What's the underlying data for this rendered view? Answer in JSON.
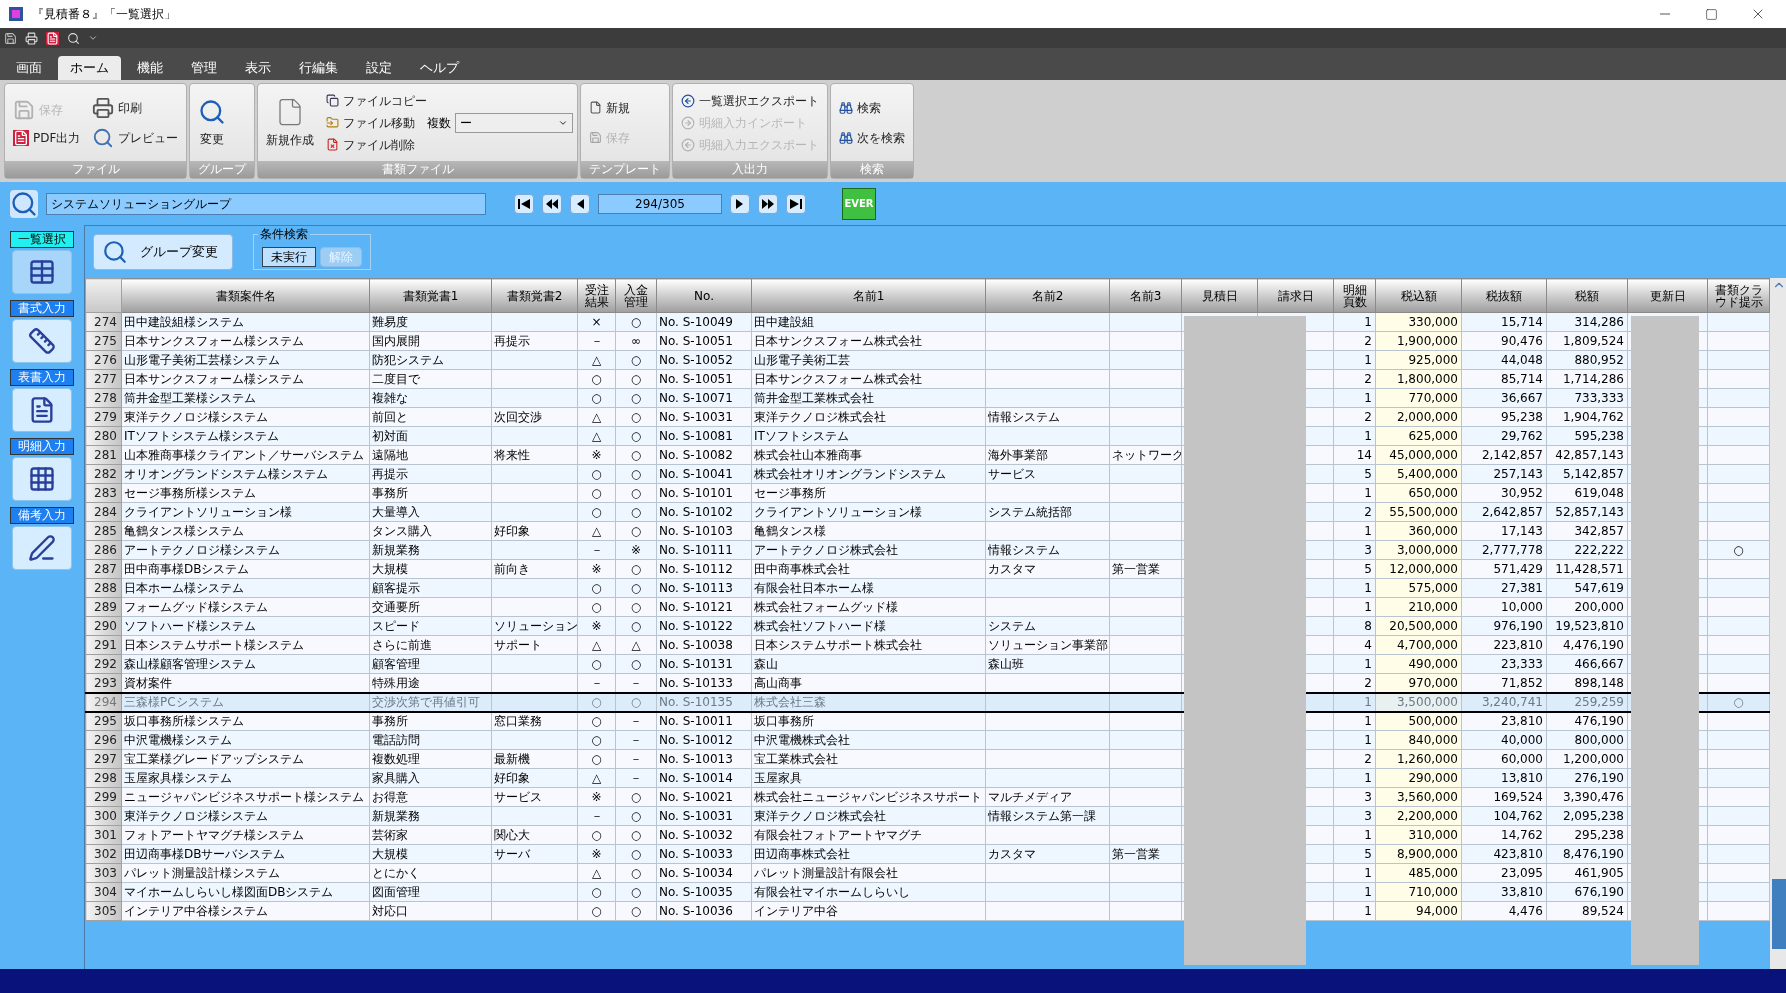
{
  "window": {
    "title": "『見積番８』「一覧選択」"
  },
  "menu_tabs": [
    {
      "label": "画面",
      "selected": false
    },
    {
      "label": "ホーム",
      "selected": true
    },
    {
      "label": "機能",
      "selected": false
    },
    {
      "label": "管理",
      "selected": false
    },
    {
      "label": "表示",
      "selected": false
    },
    {
      "label": "行編集",
      "selected": false
    },
    {
      "label": "設定",
      "selected": false
    },
    {
      "label": "ヘルプ",
      "selected": false
    }
  ],
  "ribbon": {
    "file": {
      "caption": "ファイル",
      "save": {
        "label": "保存",
        "disabled": true
      },
      "print": {
        "label": "印刷",
        "disabled": false
      },
      "pdf": {
        "label": "PDF出力",
        "disabled": false
      },
      "preview": {
        "label": "プレビュー",
        "disabled": false
      }
    },
    "group": {
      "caption": "グループ",
      "change": {
        "label": "変更",
        "disabled": false
      }
    },
    "document_file": {
      "caption": "書類ファイル",
      "new": {
        "label": "新規作成",
        "disabled": false
      },
      "copy": {
        "label": "ファイルコピー",
        "disabled": false
      },
      "move": {
        "label": "ファイル移動",
        "disabled": false
      },
      "delete": {
        "label": "ファイル削除",
        "disabled": false
      },
      "count_label": "複数",
      "count_value": "ー"
    },
    "template": {
      "caption": "テンプレート",
      "new": {
        "label": "新規",
        "disabled": false
      },
      "save": {
        "label": "保存",
        "disabled": true
      }
    },
    "io": {
      "caption": "入出力",
      "export": {
        "label": "一覧選択エクスポート",
        "disabled": false
      },
      "detail_import": {
        "label": "明細入力インポート",
        "disabled": true
      },
      "detail_export": {
        "label": "明細入力エクスポート",
        "disabled": true
      }
    },
    "search": {
      "caption": "検索",
      "find": {
        "label": "検索",
        "disabled": false
      },
      "find_next": {
        "label": "次を検索",
        "disabled": false
      }
    }
  },
  "navigator": {
    "group": "システムソリューショングループ",
    "record": "294/305",
    "ever_label": "EVER"
  },
  "sidebar": [
    {
      "label": "一覧選択",
      "selected": true
    },
    {
      "label": "書式入力",
      "selected": false
    },
    {
      "label": "表書入力",
      "selected": false
    },
    {
      "label": "明細入力",
      "selected": false
    },
    {
      "label": "備考入力",
      "selected": false
    }
  ],
  "toolbar": {
    "group_change": "グループ変更",
    "condition_search": {
      "title": "条件検索",
      "status": "未実行",
      "clear": {
        "label": "解除",
        "disabled": true
      }
    }
  },
  "table": {
    "columns": [
      "書類案件名",
      "書類覚書1",
      "書類覚書2",
      "受注結果",
      "入金管理",
      "No.",
      "名前1",
      "名前2",
      "名前3",
      "見積日",
      "請求日",
      "明細頁数",
      "税込額",
      "税抜額",
      "税額",
      "更新日",
      "書類クラウド提示"
    ],
    "rows": [
      {
        "row": "274",
        "title": "田中建設組様システム",
        "memo1": "難易度",
        "order": "×",
        "payment": "○",
        "doc_no": "No. S-10049",
        "name1": "田中建設組",
        "pages": "1",
        "tax_incl": "330,000",
        "tax_excl": "15,714",
        "tax": "314,286",
        "selected": false
      },
      {
        "row": "275",
        "title": "日本サンクスフォーム様システム",
        "memo1": "国内展開",
        "memo2": "再提示",
        "order": "－",
        "payment": "∞",
        "doc_no": "No. S-10051",
        "name1": "日本サンクスフォーム株式会社",
        "pages": "2",
        "tax_incl": "1,900,000",
        "tax_excl": "90,476",
        "tax": "1,809,524",
        "selected": false
      },
      {
        "row": "276",
        "title": "山形電子美術工芸様システム",
        "memo1": "防犯システム",
        "order": "△",
        "payment": "○",
        "doc_no": "No. S-10052",
        "name1": "山形電子美術工芸",
        "pages": "1",
        "tax_incl": "925,000",
        "tax_excl": "44,048",
        "tax": "880,952",
        "selected": false
      },
      {
        "row": "277",
        "title": "日本サンクスフォーム様システム",
        "memo1": "二度目で",
        "order": "○",
        "payment": "○",
        "doc_no": "No. S-10051",
        "name1": "日本サンクスフォーム株式会社",
        "pages": "2",
        "tax_incl": "1,800,000",
        "tax_excl": "85,714",
        "tax": "1,714,286",
        "selected": false
      },
      {
        "row": "278",
        "title": "筒井金型工業様システム",
        "memo1": "複雑な",
        "order": "○",
        "payment": "○",
        "doc_no": "No. S-10071",
        "name1": "筒井金型工業株式会社",
        "pages": "1",
        "tax_incl": "770,000",
        "tax_excl": "36,667",
        "tax": "733,333",
        "selected": false
      },
      {
        "row": "279",
        "title": "東洋テクノロジ様システム",
        "memo1": "前回と",
        "memo2": "次回交渉",
        "order": "△",
        "payment": "○",
        "doc_no": "No. S-10031",
        "name1": "東洋テクノロジ株式会社",
        "name2": "情報システム",
        "pages": "2",
        "tax_incl": "2,000,000",
        "tax_excl": "95,238",
        "tax": "1,904,762",
        "selected": false
      },
      {
        "row": "280",
        "title": "ITソフトシステム様システム",
        "memo1": "初対面",
        "order": "△",
        "payment": "○",
        "doc_no": "No. S-10081",
        "name1": "ITソフトシステム",
        "pages": "1",
        "tax_incl": "625,000",
        "tax_excl": "29,762",
        "tax": "595,238",
        "selected": false
      },
      {
        "row": "281",
        "title": "山本雅商事様クライアント／サーバシステム",
        "memo1": "遠隔地",
        "memo2": "将来性",
        "order": "※",
        "payment": "○",
        "doc_no": "No. S-10082",
        "name1": "株式会社山本雅商事",
        "name2": "海外事業部",
        "name3": "ネットワーク",
        "pages": "14",
        "tax_incl": "45,000,000",
        "tax_excl": "2,142,857",
        "tax": "42,857,143",
        "selected": false
      },
      {
        "row": "282",
        "title": "オリオングランドシステム様システム",
        "memo1": "再提示",
        "order": "○",
        "payment": "○",
        "doc_no": "No. S-10041",
        "name1": "株式会社オリオングランドシステム",
        "name2": "サービス",
        "pages": "5",
        "tax_incl": "5,400,000",
        "tax_excl": "257,143",
        "tax": "5,142,857",
        "selected": false
      },
      {
        "row": "283",
        "title": "セージ事務所様システム",
        "memo1": "事務所",
        "order": "○",
        "payment": "○",
        "doc_no": "No. S-10101",
        "name1": "セージ事務所",
        "pages": "1",
        "tax_incl": "650,000",
        "tax_excl": "30,952",
        "tax": "619,048",
        "selected": false
      },
      {
        "row": "284",
        "title": "クライアントソリューション様",
        "memo1": "大量導入",
        "order": "○",
        "payment": "○",
        "doc_no": "No. S-10102",
        "name1": "クライアントソリューション様",
        "name2": "システム統括部",
        "pages": "2",
        "tax_incl": "55,500,000",
        "tax_excl": "2,642,857",
        "tax": "52,857,143",
        "selected": false
      },
      {
        "row": "285",
        "title": "亀鶴タンス様システム",
        "memo1": "タンス購入",
        "memo2": "好印象",
        "order": "△",
        "payment": "○",
        "doc_no": "No. S-10103",
        "name1": "亀鶴タンス様",
        "pages": "1",
        "tax_incl": "360,000",
        "tax_excl": "17,143",
        "tax": "342,857",
        "selected": false
      },
      {
        "row": "286",
        "title": "アートテクノロジ様システム",
        "memo1": "新規業務",
        "order": "－",
        "payment": "※",
        "doc_no": "No. S-10111",
        "name1": "アートテクノロジ株式会社",
        "name2": "情報システム",
        "pages": "3",
        "tax_incl": "3,000,000",
        "tax_excl": "2,777,778",
        "tax": "222,222",
        "cloud": "○",
        "selected": false
      },
      {
        "row": "287",
        "title": "田中商事様DBシステム",
        "memo1": "大規模",
        "memo2": "前向き",
        "order": "※",
        "payment": "○",
        "doc_no": "No. S-10112",
        "name1": "田中商事株式会社",
        "name2": "カスタマ",
        "name3": "第一営業",
        "pages": "5",
        "tax_incl": "12,000,000",
        "tax_excl": "571,429",
        "tax": "11,428,571",
        "selected": false
      },
      {
        "row": "288",
        "title": "日本ホーム様システム",
        "memo1": "顧客提示",
        "order": "○",
        "payment": "○",
        "doc_no": "No. S-10113",
        "name1": "有限会社日本ホーム様",
        "pages": "1",
        "tax_incl": "575,000",
        "tax_excl": "27,381",
        "tax": "547,619",
        "selected": false
      },
      {
        "row": "289",
        "title": "フォームグッド様システム",
        "memo1": "交通要所",
        "order": "○",
        "payment": "○",
        "doc_no": "No. S-10121",
        "name1": "株式会社フォームグッド様",
        "pages": "1",
        "tax_incl": "210,000",
        "tax_excl": "10,000",
        "tax": "200,000",
        "selected": false
      },
      {
        "row": "290",
        "title": "ソフトハード様システム",
        "memo1": "スピード",
        "memo2": "ソリューション",
        "order": "※",
        "payment": "○",
        "doc_no": "No. S-10122",
        "name1": "株式会社ソフトハード様",
        "name2": "システム",
        "pages": "8",
        "tax_incl": "20,500,000",
        "tax_excl": "976,190",
        "tax": "19,523,810",
        "selected": false
      },
      {
        "row": "291",
        "title": "日本システムサポート様システム",
        "memo1": "さらに前進",
        "memo2": "サポート",
        "order": "△",
        "payment": "△",
        "doc_no": "No. S-10038",
        "name1": "日本システムサポート株式会社",
        "name2": "ソリューション事業部",
        "pages": "4",
        "tax_incl": "4,700,000",
        "tax_excl": "223,810",
        "tax": "4,476,190",
        "selected": false
      },
      {
        "row": "292",
        "title": "森山様顧客管理システム",
        "memo1": "顧客管理",
        "order": "○",
        "payment": "○",
        "doc_no": "No. S-10131",
        "name1": "森山",
        "name2": "森山班",
        "pages": "1",
        "tax_incl": "490,000",
        "tax_excl": "23,333",
        "tax": "466,667",
        "selected": false
      },
      {
        "row": "293",
        "title": "資材案件",
        "memo1": "特殊用途",
        "order": "－",
        "payment": "－",
        "doc_no": "No. S-10133",
        "name1": "高山商事",
        "pages": "2",
        "tax_incl": "970,000",
        "tax_excl": "71,852",
        "tax": "898,148",
        "selected": false
      },
      {
        "row": "294",
        "title": "三森様PCシステム",
        "memo1": "交渉次第で再値引可",
        "order": "○",
        "payment": "○",
        "doc_no": "No. S-10135",
        "name1": "株式会社三森",
        "pages": "1",
        "tax_incl": "3,500,000",
        "tax_excl": "3,240,741",
        "tax": "259,259",
        "cloud": "○",
        "selected": true
      },
      {
        "row": "295",
        "title": "坂口事務所様システム",
        "memo1": "事務所",
        "memo2": "窓口業務",
        "order": "○",
        "payment": "－",
        "doc_no": "No. S-10011",
        "name1": "坂口事務所",
        "pages": "1",
        "tax_incl": "500,000",
        "tax_excl": "23,810",
        "tax": "476,190",
        "selected": false
      },
      {
        "row": "296",
        "title": "中沢電機様システム",
        "memo1": "電話訪問",
        "order": "○",
        "payment": "－",
        "doc_no": "No. S-10012",
        "name1": "中沢電機株式会社",
        "pages": "1",
        "tax_incl": "840,000",
        "tax_excl": "40,000",
        "tax": "800,000",
        "selected": false
      },
      {
        "row": "297",
        "title": "宝工業様グレードアップシステム",
        "memo1": "複数処理",
        "memo2": "最新機",
        "order": "○",
        "payment": "－",
        "doc_no": "No. S-10013",
        "name1": "宝工業株式会社",
        "pages": "2",
        "tax_incl": "1,260,000",
        "tax_excl": "60,000",
        "tax": "1,200,000",
        "selected": false
      },
      {
        "row": "298",
        "title": "玉屋家具様システム",
        "memo1": "家具購入",
        "memo2": "好印象",
        "order": "△",
        "payment": "－",
        "doc_no": "No. S-10014",
        "name1": "玉屋家具",
        "pages": "1",
        "tax_incl": "290,000",
        "tax_excl": "13,810",
        "tax": "276,190",
        "selected": false
      },
      {
        "row": "299",
        "title": "ニュージャパンビジネスサポート様システム",
        "memo1": "お得意",
        "memo2": "サービス",
        "order": "※",
        "payment": "○",
        "doc_no": "No. S-10021",
        "name1": "株式会社ニュージャパンビジネスサポート",
        "name2": "マルチメディア",
        "pages": "3",
        "tax_incl": "3,560,000",
        "tax_excl": "169,524",
        "tax": "3,390,476",
        "selected": false
      },
      {
        "row": "300",
        "title": "東洋テクノロジ様システム",
        "memo1": "新規業務",
        "order": "－",
        "payment": "○",
        "doc_no": "No. S-10031",
        "name1": "東洋テクノロジ株式会社",
        "name2": "情報システム第一課",
        "pages": "3",
        "tax_incl": "2,200,000",
        "tax_excl": "104,762",
        "tax": "2,095,238",
        "selected": false
      },
      {
        "row": "301",
        "title": "フォトアートヤマグチ様システム",
        "memo1": "芸術家",
        "memo2": "関心大",
        "order": "○",
        "payment": "○",
        "doc_no": "No. S-10032",
        "name1": "有限会社フォトアートヤマグチ",
        "pages": "1",
        "tax_incl": "310,000",
        "tax_excl": "14,762",
        "tax": "295,238",
        "selected": false
      },
      {
        "row": "302",
        "title": "田辺商事様DBサーバシステム",
        "memo1": "大規模",
        "memo2": "サーバ",
        "order": "※",
        "payment": "○",
        "doc_no": "No. S-10033",
        "name1": "田辺商事株式会社",
        "name2": "カスタマ",
        "name3": "第一営業",
        "pages": "5",
        "tax_incl": "8,900,000",
        "tax_excl": "423,810",
        "tax": "8,476,190",
        "selected": false
      },
      {
        "row": "303",
        "title": "パレット測量設計様システム",
        "memo1": "とにかく",
        "order": "△",
        "payment": "○",
        "doc_no": "No. S-10034",
        "name1": "パレット測量設計有限会社",
        "pages": "1",
        "tax_incl": "485,000",
        "tax_excl": "23,095",
        "tax": "461,905",
        "selected": false
      },
      {
        "row": "304",
        "title": "マイホームしらいし様図面DBシステム",
        "memo1": "図面管理",
        "order": "○",
        "payment": "○",
        "doc_no": "No. S-10035",
        "name1": "有限会社マイホームしらいし",
        "pages": "1",
        "tax_incl": "710,000",
        "tax_excl": "33,810",
        "tax": "676,190",
        "selected": false
      },
      {
        "row": "305",
        "title": "インテリア中谷様システム",
        "memo1": "対応口",
        "order": "○",
        "payment": "○",
        "doc_no": "No. S-10036",
        "name1": "インテリア中谷",
        "pages": "1",
        "tax_incl": "94,000",
        "tax_excl": "4,476",
        "tax": "89,524",
        "selected": false
      }
    ]
  }
}
